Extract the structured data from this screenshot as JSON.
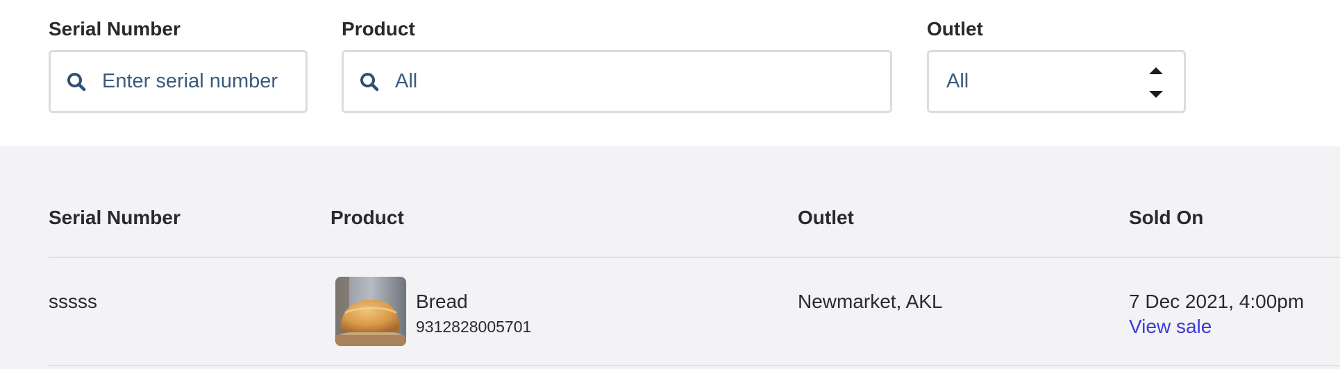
{
  "filters": {
    "serial_number": {
      "label": "Serial Number",
      "placeholder": "Enter serial number",
      "icon": "search-icon"
    },
    "product": {
      "label": "Product",
      "value": "All",
      "icon": "search-icon"
    },
    "outlet": {
      "label": "Outlet",
      "value": "All",
      "icon": "sort-arrows-icon"
    }
  },
  "table": {
    "columns": {
      "serial_number": "Serial Number",
      "product": "Product",
      "outlet": "Outlet",
      "sold_on": "Sold On"
    },
    "rows": [
      {
        "serial_number": "sssss",
        "product_name": "Bread",
        "product_sku": "9312828005701",
        "product_image": "bread-loaf-thumbnail",
        "outlet": "Newmarket, AKL",
        "sold_on": "7 Dec 2021, 4:00pm",
        "view_link": "View sale"
      }
    ]
  },
  "colors": {
    "table_background": "#f3f2f4",
    "input_text": "#3a5a7c",
    "link": "#3b3bdb",
    "border": "#dcdce0"
  }
}
